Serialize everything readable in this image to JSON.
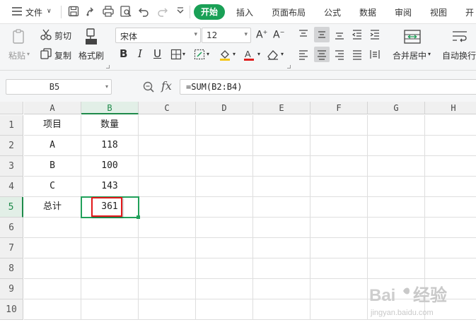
{
  "menubar": {
    "file_label": "文件",
    "tabs": [
      {
        "label": "开始",
        "active": true
      },
      {
        "label": "插入"
      },
      {
        "label": "页面布局"
      },
      {
        "label": "公式"
      },
      {
        "label": "数据"
      },
      {
        "label": "审阅"
      },
      {
        "label": "视图"
      },
      {
        "label": "开"
      }
    ]
  },
  "ribbon": {
    "paste_label": "粘贴",
    "cut_label": "剪切",
    "copy_label": "复制",
    "format_painter_label": "格式刷",
    "font_name": "宋体",
    "font_size": "12",
    "merge_center_label": "合并居中",
    "wrap_text_label": "自动换行"
  },
  "formula_bar": {
    "name_box": "B5",
    "fx_label": "fx",
    "formula": "=SUM(B2:B4)"
  },
  "sheet": {
    "columns": [
      "A",
      "B",
      "C",
      "D",
      "E",
      "F",
      "G",
      "H"
    ],
    "rows": [
      "1",
      "2",
      "3",
      "4",
      "5",
      "6",
      "7",
      "8",
      "9",
      "10"
    ],
    "cells": {
      "A1": "项目",
      "B1": "数量",
      "A2": "A",
      "B2": "118",
      "A3": "B",
      "B3": "100",
      "A4": "C",
      "B4": "143",
      "A5": "总计",
      "B5": "361"
    },
    "active_cell": "B5"
  },
  "watermark": {
    "text": "Baidu 经验",
    "url": "jingyan.baidu.com"
  },
  "colors": {
    "accent_green": "#1aa056",
    "highlight_red": "#e3191b"
  }
}
